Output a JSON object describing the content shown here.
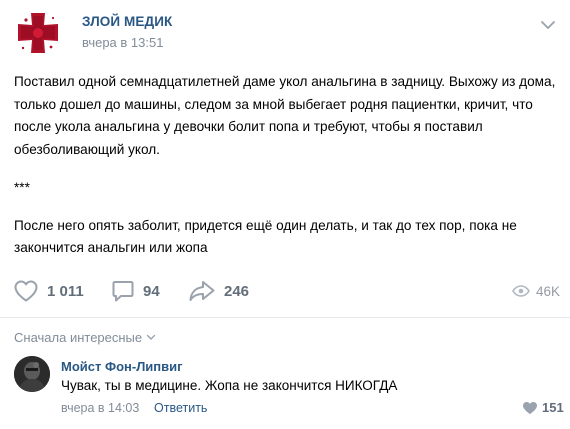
{
  "post": {
    "author": "ЗЛОЙ МЕДИК",
    "time": "вчера в 13:51",
    "avatar_icon": "red-cross-icon",
    "text": {
      "p1": "Поставил одной семнадцатилетней даме укол анальгина в задницу. Выхожу из дома, только дошел до машины, следом за мной выбегает родня пациентки, кричит, что после укола анальгина у девочки болит попа и требуют, чтобы я поставил обезболивающий укол.",
      "p2": "***",
      "p3": "После него опять заболит, придется ещё один делать, и так до тех пор, пока не закончится анальгин или жопа"
    },
    "actions": {
      "likes": "1 011",
      "comments": "94",
      "shares": "246",
      "views": "46K"
    }
  },
  "comments_section": {
    "sort_label": "Сначала интересные",
    "comments": [
      {
        "author": "Мойст Фон-Липвиг",
        "text": "Чувак, ты в медицине. Жопа не закончится НИКОГДА",
        "time": "вчера в 14:03",
        "reply_label": "Ответить",
        "likes": "151"
      }
    ]
  },
  "colors": {
    "link": "#2a5885",
    "muted": "#818c99",
    "icon": "#99a2ad",
    "divider": "#e7e8ec",
    "brand_red": "#c8102e"
  }
}
